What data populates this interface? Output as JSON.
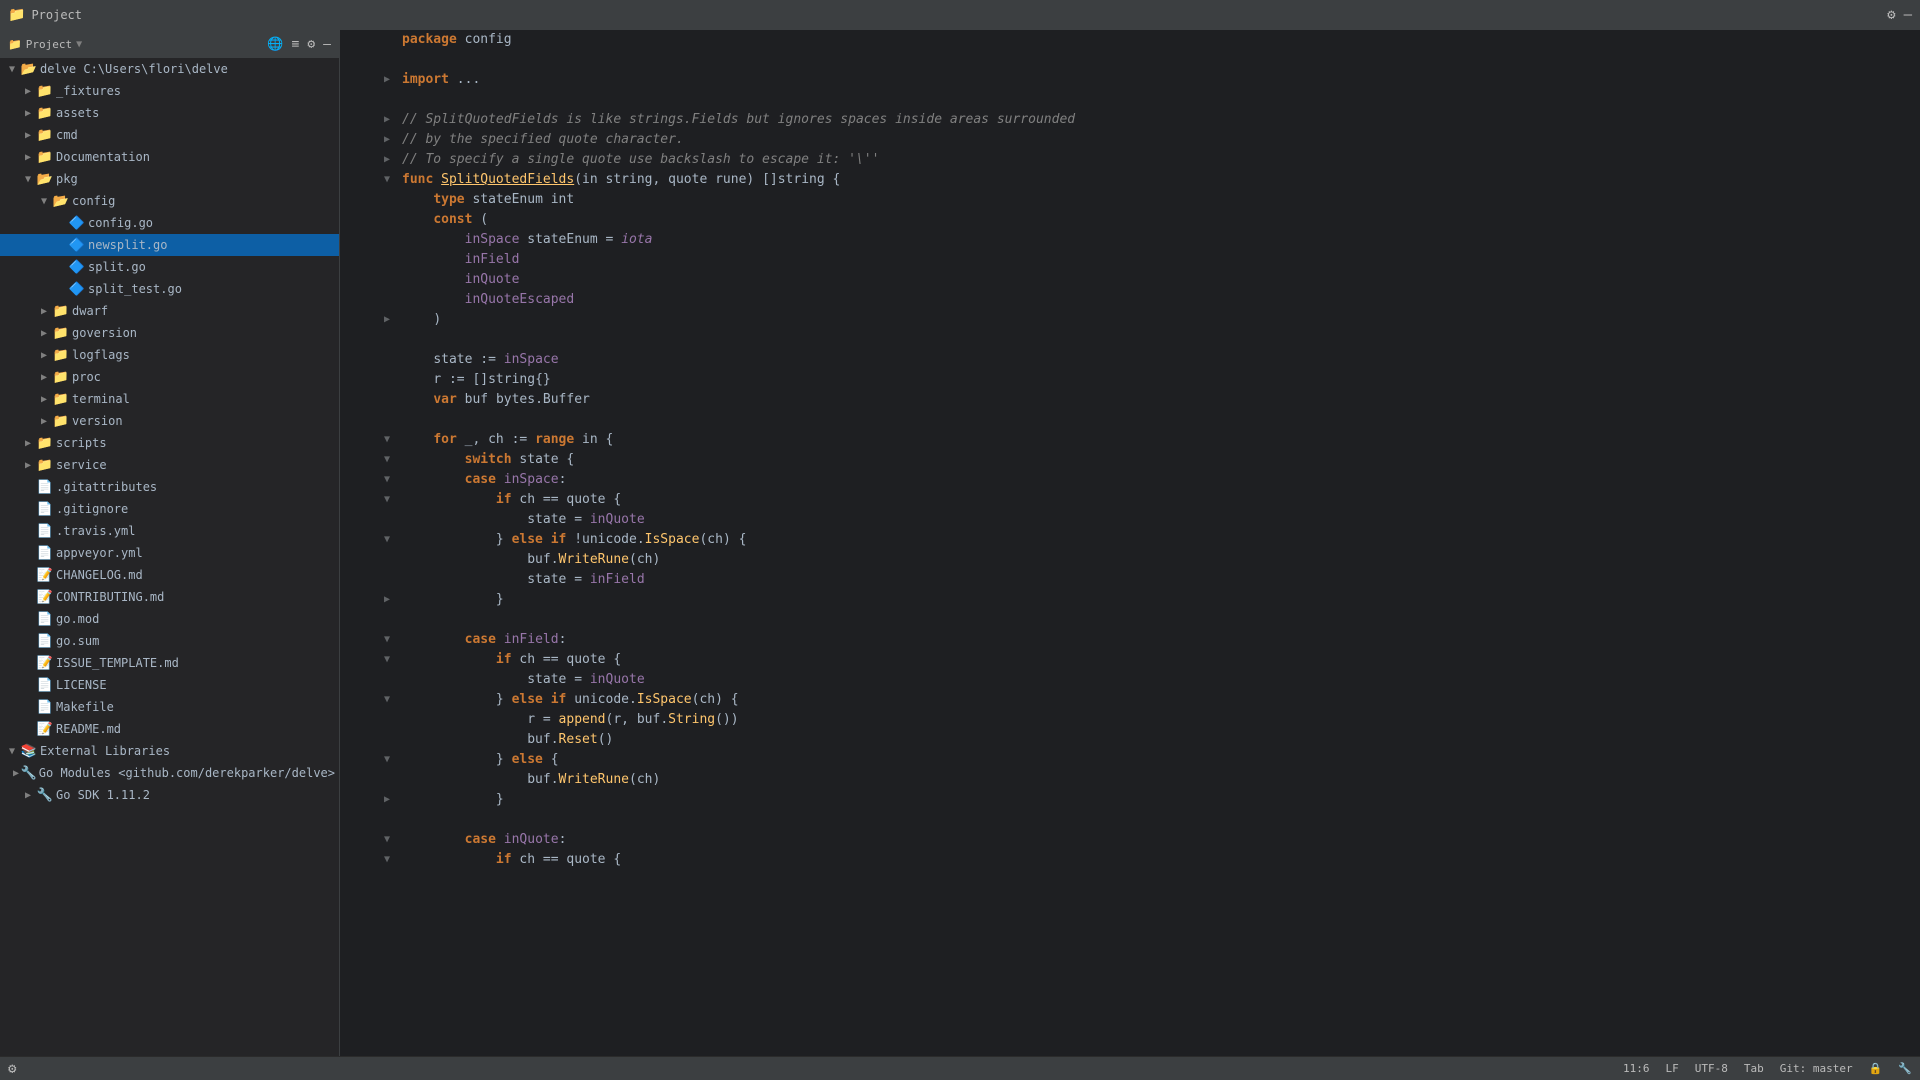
{
  "titleBar": {
    "icon": "📁",
    "title": "Project",
    "controls": [
      "⚙",
      "—",
      "□",
      "✕"
    ]
  },
  "sidebar": {
    "header": "Project",
    "headerIcons": [
      "🌐",
      "≡",
      "⚙",
      "—"
    ],
    "tree": [
      {
        "id": "delve-root",
        "label": "delve C:\\Users\\flori\\delve",
        "depth": 0,
        "type": "folder-open",
        "expanded": true
      },
      {
        "id": "_fixtures",
        "label": "_fixtures",
        "depth": 1,
        "type": "folder",
        "expanded": false
      },
      {
        "id": "assets",
        "label": "assets",
        "depth": 1,
        "type": "folder",
        "expanded": false
      },
      {
        "id": "cmd",
        "label": "cmd",
        "depth": 1,
        "type": "folder",
        "expanded": false
      },
      {
        "id": "Documentation",
        "label": "Documentation",
        "depth": 1,
        "type": "folder",
        "expanded": false
      },
      {
        "id": "pkg",
        "label": "pkg",
        "depth": 1,
        "type": "folder-open",
        "expanded": true
      },
      {
        "id": "config",
        "label": "config",
        "depth": 2,
        "type": "folder-open",
        "expanded": true
      },
      {
        "id": "config.go",
        "label": "config.go",
        "depth": 3,
        "type": "go"
      },
      {
        "id": "newsplit.go",
        "label": "newsplit.go",
        "depth": 3,
        "type": "go",
        "selected": true
      },
      {
        "id": "split.go",
        "label": "split.go",
        "depth": 3,
        "type": "go"
      },
      {
        "id": "split_test.go",
        "label": "split_test.go",
        "depth": 3,
        "type": "go"
      },
      {
        "id": "dwarf",
        "label": "dwarf",
        "depth": 2,
        "type": "folder",
        "expanded": false
      },
      {
        "id": "goversion",
        "label": "goversion",
        "depth": 2,
        "type": "folder",
        "expanded": false
      },
      {
        "id": "logflags",
        "label": "logflags",
        "depth": 2,
        "type": "folder",
        "expanded": false
      },
      {
        "id": "proc",
        "label": "proc",
        "depth": 2,
        "type": "folder",
        "expanded": false
      },
      {
        "id": "terminal",
        "label": "terminal",
        "depth": 2,
        "type": "folder",
        "expanded": false
      },
      {
        "id": "version",
        "label": "version",
        "depth": 2,
        "type": "folder",
        "expanded": false
      },
      {
        "id": "scripts",
        "label": "scripts",
        "depth": 1,
        "type": "folder",
        "expanded": false
      },
      {
        "id": "service",
        "label": "service",
        "depth": 1,
        "type": "folder",
        "expanded": false
      },
      {
        "id": ".gitattributes",
        "label": ".gitattributes",
        "depth": 1,
        "type": "file"
      },
      {
        "id": ".gitignore",
        "label": ".gitignore",
        "depth": 1,
        "type": "file"
      },
      {
        "id": ".travis.yml",
        "label": ".travis.yml",
        "depth": 1,
        "type": "yaml"
      },
      {
        "id": "appveyor.yml",
        "label": "appveyor.yml",
        "depth": 1,
        "type": "yaml"
      },
      {
        "id": "CHANGELOG.md",
        "label": "CHANGELOG.md",
        "depth": 1,
        "type": "md"
      },
      {
        "id": "CONTRIBUTING.md",
        "label": "CONTRIBUTING.md",
        "depth": 1,
        "type": "md"
      },
      {
        "id": "go.mod",
        "label": "go.mod",
        "depth": 1,
        "type": "mod"
      },
      {
        "id": "go.sum",
        "label": "go.sum",
        "depth": 1,
        "type": "mod"
      },
      {
        "id": "ISSUE_TEMPLATE.md",
        "label": "ISSUE_TEMPLATE.md",
        "depth": 1,
        "type": "md"
      },
      {
        "id": "LICENSE",
        "label": "LICENSE",
        "depth": 1,
        "type": "file"
      },
      {
        "id": "Makefile",
        "label": "Makefile",
        "depth": 1,
        "type": "file"
      },
      {
        "id": "README.md",
        "label": "README.md",
        "depth": 1,
        "type": "md"
      },
      {
        "id": "external-libraries",
        "label": "External Libraries",
        "depth": 0,
        "type": "folder-open",
        "expanded": true
      },
      {
        "id": "go-modules",
        "label": "Go Modules <github.com/derekparker/delve>",
        "depth": 1,
        "type": "folder",
        "expanded": false
      },
      {
        "id": "go-sdk",
        "label": "Go SDK 1.11.2",
        "depth": 1,
        "type": "folder",
        "expanded": false
      }
    ]
  },
  "editor": {
    "packageLine": "package config",
    "lines": []
  },
  "statusBar": {
    "left": [],
    "lineCol": "11:6",
    "lineEnding": "LF",
    "encoding": "UTF-8",
    "indentType": "Tab",
    "vcs": "Git: master",
    "settingsIcon": "⚙",
    "icons": [
      "🔒",
      "🔧"
    ]
  }
}
